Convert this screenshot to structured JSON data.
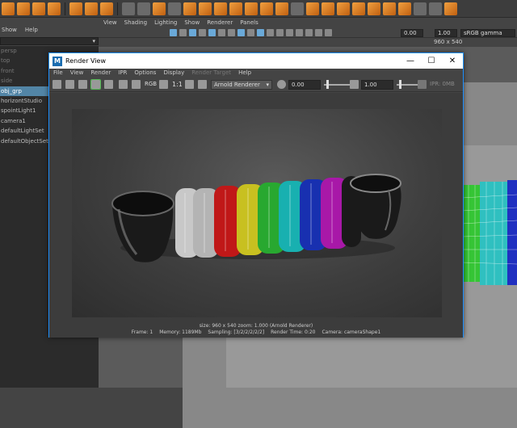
{
  "maya": {
    "outliner_menu": [
      "Show",
      "Help"
    ],
    "outliner_items": [
      {
        "label": "persp",
        "state": "dim"
      },
      {
        "label": "top",
        "state": "dim"
      },
      {
        "label": "front",
        "state": "dim"
      },
      {
        "label": "side",
        "state": "dim"
      },
      {
        "label": "obj_grp",
        "state": "selected"
      },
      {
        "label": "horizontStudio",
        "state": "normal"
      },
      {
        "label": "spointLight1",
        "state": "normal"
      },
      {
        "label": "camera1",
        "state": "normal"
      },
      {
        "label": "defaultLightSet",
        "state": "normal"
      },
      {
        "label": "defaultObjectSet",
        "state": "normal"
      }
    ],
    "viewport_menu": [
      "View",
      "Shading",
      "Lighting",
      "Show",
      "Renderer",
      "Panels"
    ],
    "viewport_fields": {
      "value1": "0.00",
      "value2": "1.00",
      "colorspace": "sRGB gamma"
    },
    "resolution_label": "960 x 540"
  },
  "render_view": {
    "title": "Render View",
    "logo": "M",
    "window_controls": {
      "minimize": "—",
      "maximize": "☐",
      "close": "✕"
    },
    "menu": [
      "File",
      "View",
      "Render",
      "IPR",
      "Options",
      "Display"
    ],
    "menu_disabled": "Render Target",
    "menu_help": "Help",
    "toolbar": {
      "rgb_label": "RGB",
      "ratio_label": "1:1",
      "renderer": "Arnold Renderer",
      "exposure": "0.00",
      "gamma": "1.00",
      "ipr_status": "IPR: 0MB"
    },
    "status_line1": "size: 960 x 540  zoom: 1.000     (Arnold Renderer)",
    "status_line2": {
      "frame": "Frame: 1",
      "memory": "Memory: 1189Mb",
      "sampling": "Sampling: [3/2/2/2/2/2]",
      "render_time": "Render Time: 0:20",
      "camera": "Camera: cameraShape1"
    }
  },
  "colors": {
    "selection": "#5285a6",
    "window_border": "#1e90ff",
    "ring_colors": [
      "#c8c8c8",
      "#b4b4b4",
      "#c01818",
      "#c8c020",
      "#28a830",
      "#18b0b0",
      "#1830b0",
      "#a818a8",
      "#1a1a1a"
    ]
  }
}
